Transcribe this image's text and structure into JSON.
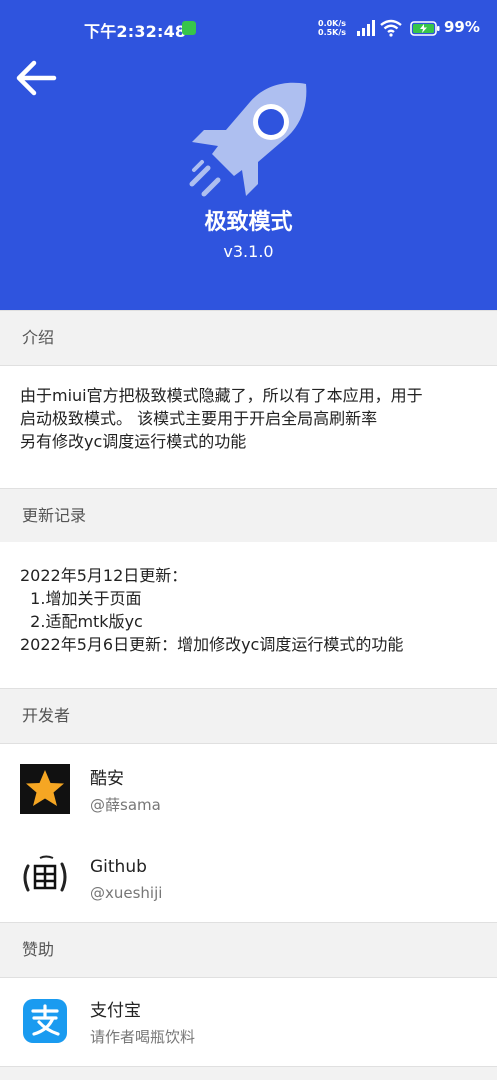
{
  "status_bar": {
    "time": "下午2:32:48",
    "net_up": "0.0K/s",
    "net_down": "0.5K/s",
    "battery": "99%"
  },
  "header": {
    "title": "极致模式",
    "version": "v3.1.0",
    "bg_color": "#2f54de"
  },
  "intro": {
    "section_label": "介绍",
    "lines": [
      "由于miui官方把极致模式隐藏了，所以有了本应用，用于",
      "启动极致模式。 该模式主要用于开启全局高刷新率",
      "另有修改yc调度运行模式的功能"
    ]
  },
  "changelog": {
    "section_label": "更新记录",
    "lines": [
      "2022年5月12日更新：",
      "  1.增加关于页面",
      "  2.适配mtk版yc",
      "2022年5月6日更新：增加修改yc调度运行模式的功能"
    ]
  },
  "developers": {
    "section_label": "开发者",
    "items": [
      {
        "title": "酷安",
        "subtitle": "@薛sama",
        "icon": "star-icon"
      },
      {
        "title": "Github",
        "subtitle": "@xueshiji",
        "icon": "seal-avatar-icon"
      }
    ]
  },
  "sponsor": {
    "section_label": "赞助",
    "items": [
      {
        "title": "支付宝",
        "subtitle": "请作者喝瓶饮料",
        "icon": "alipay-icon"
      }
    ]
  }
}
